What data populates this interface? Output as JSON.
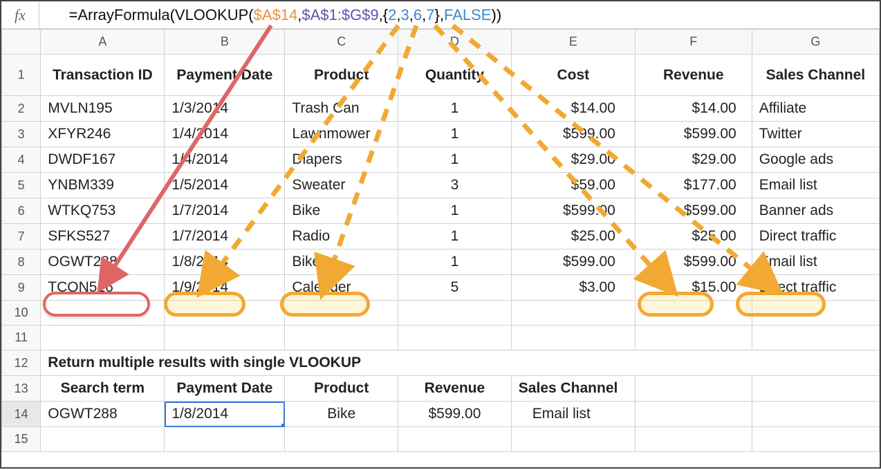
{
  "formula": {
    "prefix": "=",
    "fn1": "ArrayFormula",
    "open1": "(",
    "fn2": "VLOOKUP",
    "open2": "(",
    "arg1": "$A$14",
    "comma1": ",",
    "arg2": "$A$1:$G$9",
    "comma2": ",",
    "brace_open": "{",
    "n1": "2",
    "comma3": ",",
    "n2": "3",
    "comma4": ",",
    "n3": "6",
    "comma5": ",",
    "n4": "7",
    "brace_close": "}",
    "comma6": ",",
    "arg4": "FALSE",
    "close2": ")",
    "close1": ")"
  },
  "col_headers": [
    "A",
    "B",
    "C",
    "D",
    "E",
    "F",
    "G"
  ],
  "headers_row1": {
    "A": "Transaction ID",
    "B": "Payment Date",
    "C": "Product",
    "D": "Quantity",
    "E": "Cost",
    "F": "Revenue",
    "G": "Sales Channel"
  },
  "rows": [
    {
      "n": "2",
      "A": "MVLN195",
      "B": "1/3/2014",
      "C": "Trash Can",
      "D": "1",
      "E": "$14.00",
      "F": "$14.00",
      "G": "Affiliate"
    },
    {
      "n": "3",
      "A": "XFYR246",
      "B": "1/4/2014",
      "C": "Lawnmower",
      "D": "1",
      "E": "$599.00",
      "F": "$599.00",
      "G": "Twitter"
    },
    {
      "n": "4",
      "A": "DWDF167",
      "B": "1/4/2014",
      "C": "Diapers",
      "D": "1",
      "E": "$29.00",
      "F": "$29.00",
      "G": "Google ads"
    },
    {
      "n": "5",
      "A": "YNBM339",
      "B": "1/5/2014",
      "C": "Sweater",
      "D": "3",
      "E": "$59.00",
      "F": "$177.00",
      "G": "Email list"
    },
    {
      "n": "6",
      "A": "WTKQ753",
      "B": "1/7/2014",
      "C": "Bike",
      "D": "1",
      "E": "$599.00",
      "F": "$599.00",
      "G": "Banner ads"
    },
    {
      "n": "7",
      "A": "SFKS527",
      "B": "1/7/2014",
      "C": "Radio",
      "D": "1",
      "E": "$25.00",
      "F": "$25.00",
      "G": "Direct traffic"
    },
    {
      "n": "8",
      "A": "OGWT288",
      "B": "1/8/2014",
      "C": "Bike",
      "D": "1",
      "E": "$599.00",
      "F": "$599.00",
      "G": "Email list"
    },
    {
      "n": "9",
      "A": "TCQN516",
      "B": "1/9/2014",
      "C": "Calender",
      "D": "5",
      "E": "$3.00",
      "F": "$15.00",
      "G": "Direct traffic"
    }
  ],
  "row10": {
    "n": "10"
  },
  "row11": {
    "n": "11"
  },
  "row12": {
    "n": "12",
    "A": "Return multiple results with single VLOOKUP"
  },
  "row13": {
    "n": "13",
    "A": "Search term",
    "B": "Payment Date",
    "C": "Product",
    "D": "Revenue",
    "E": "Sales Channel"
  },
  "row14": {
    "n": "14",
    "A": "OGWT288",
    "B": "1/8/2014",
    "C": "Bike",
    "D": "$599.00",
    "E": "Email list"
  },
  "row15": {
    "n": "15"
  },
  "chart_data": {
    "type": "table",
    "title": "Return multiple results with single VLOOKUP",
    "columns": [
      "Transaction ID",
      "Payment Date",
      "Product",
      "Quantity",
      "Cost",
      "Revenue",
      "Sales Channel"
    ],
    "rows": [
      [
        "MVLN195",
        "1/3/2014",
        "Trash Can",
        1,
        14.0,
        14.0,
        "Affiliate"
      ],
      [
        "XFYR246",
        "1/4/2014",
        "Lawnmower",
        1,
        599.0,
        599.0,
        "Twitter"
      ],
      [
        "DWDF167",
        "1/4/2014",
        "Diapers",
        1,
        29.0,
        29.0,
        "Google ads"
      ],
      [
        "YNBM339",
        "1/5/2014",
        "Sweater",
        3,
        59.0,
        177.0,
        "Email list"
      ],
      [
        "WTKQ753",
        "1/7/2014",
        "Bike",
        1,
        599.0,
        599.0,
        "Banner ads"
      ],
      [
        "SFKS527",
        "1/7/2014",
        "Radio",
        1,
        25.0,
        25.0,
        "Direct traffic"
      ],
      [
        "OGWT288",
        "1/8/2014",
        "Bike",
        1,
        599.0,
        599.0,
        "Email list"
      ],
      [
        "TCQN516",
        "1/9/2014",
        "Calender",
        5,
        3.0,
        15.0,
        "Direct traffic"
      ]
    ],
    "lookup": {
      "search_term": "OGWT288",
      "returns": {
        "Payment Date": "1/8/2014",
        "Product": "Bike",
        "Revenue": 599.0,
        "Sales Channel": "Email list"
      },
      "column_indices": [
        2,
        3,
        6,
        7
      ]
    }
  }
}
